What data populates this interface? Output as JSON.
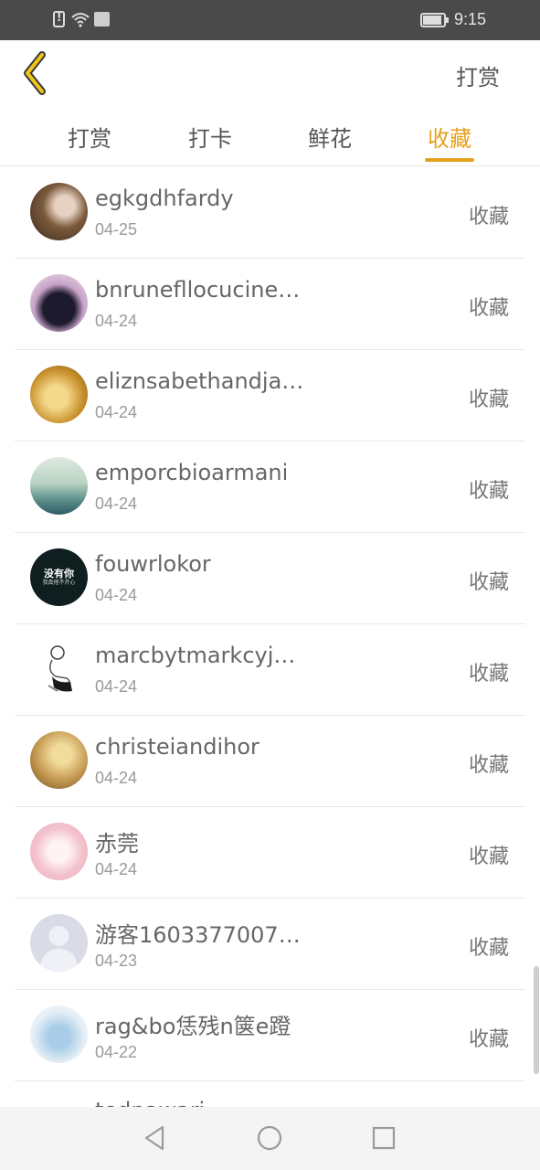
{
  "status_bar": {
    "time": "9:15",
    "icons": [
      "alert-icon",
      "wifi-icon",
      "sms-icon",
      "battery-icon"
    ]
  },
  "header": {
    "back_icon": "chevron-left-icon",
    "action_label": "打赏"
  },
  "tabs": [
    {
      "label": "打赏",
      "active": false
    },
    {
      "label": "打卡",
      "active": false
    },
    {
      "label": "鲜花",
      "active": false
    },
    {
      "label": "收藏",
      "active": true
    }
  ],
  "colors": {
    "accent": "#e6a11c",
    "status_bar_bg": "#4a4a4a",
    "divider": "#e8e8e8"
  },
  "list": [
    {
      "name": "egkgdhfardy",
      "date": "04-25",
      "action": "收藏"
    },
    {
      "name": "bnruneflloсucinegroo",
      "date": "04-24",
      "action": "收藏"
    },
    {
      "name": "eliznsabethandjames",
      "date": "04-24",
      "action": "收藏"
    },
    {
      "name": "emporcbioarmani",
      "date": "04-24",
      "action": "收藏"
    },
    {
      "name": "fouwrlokor",
      "date": "04-24",
      "action": "收藏",
      "avatar_text": [
        "没有你",
        "我真他不开心"
      ]
    },
    {
      "name": "marcbytmarkcyjacobs",
      "date": "04-24",
      "action": "收藏"
    },
    {
      "name": "christeiandihor",
      "date": "04-24",
      "action": "收藏"
    },
    {
      "name": "赤莞",
      "date": "04-24",
      "action": "收藏"
    },
    {
      "name": "游客1603377007…",
      "date": "04-23",
      "action": "收藏"
    },
    {
      "name": "rag&bo恁残n箧e蹬",
      "date": "04-22",
      "action": "收藏"
    }
  ],
  "partial_next_name": "tedpawari",
  "nav_bar": {
    "icons": [
      "nav-back-icon",
      "nav-home-icon",
      "nav-recent-icon"
    ]
  }
}
